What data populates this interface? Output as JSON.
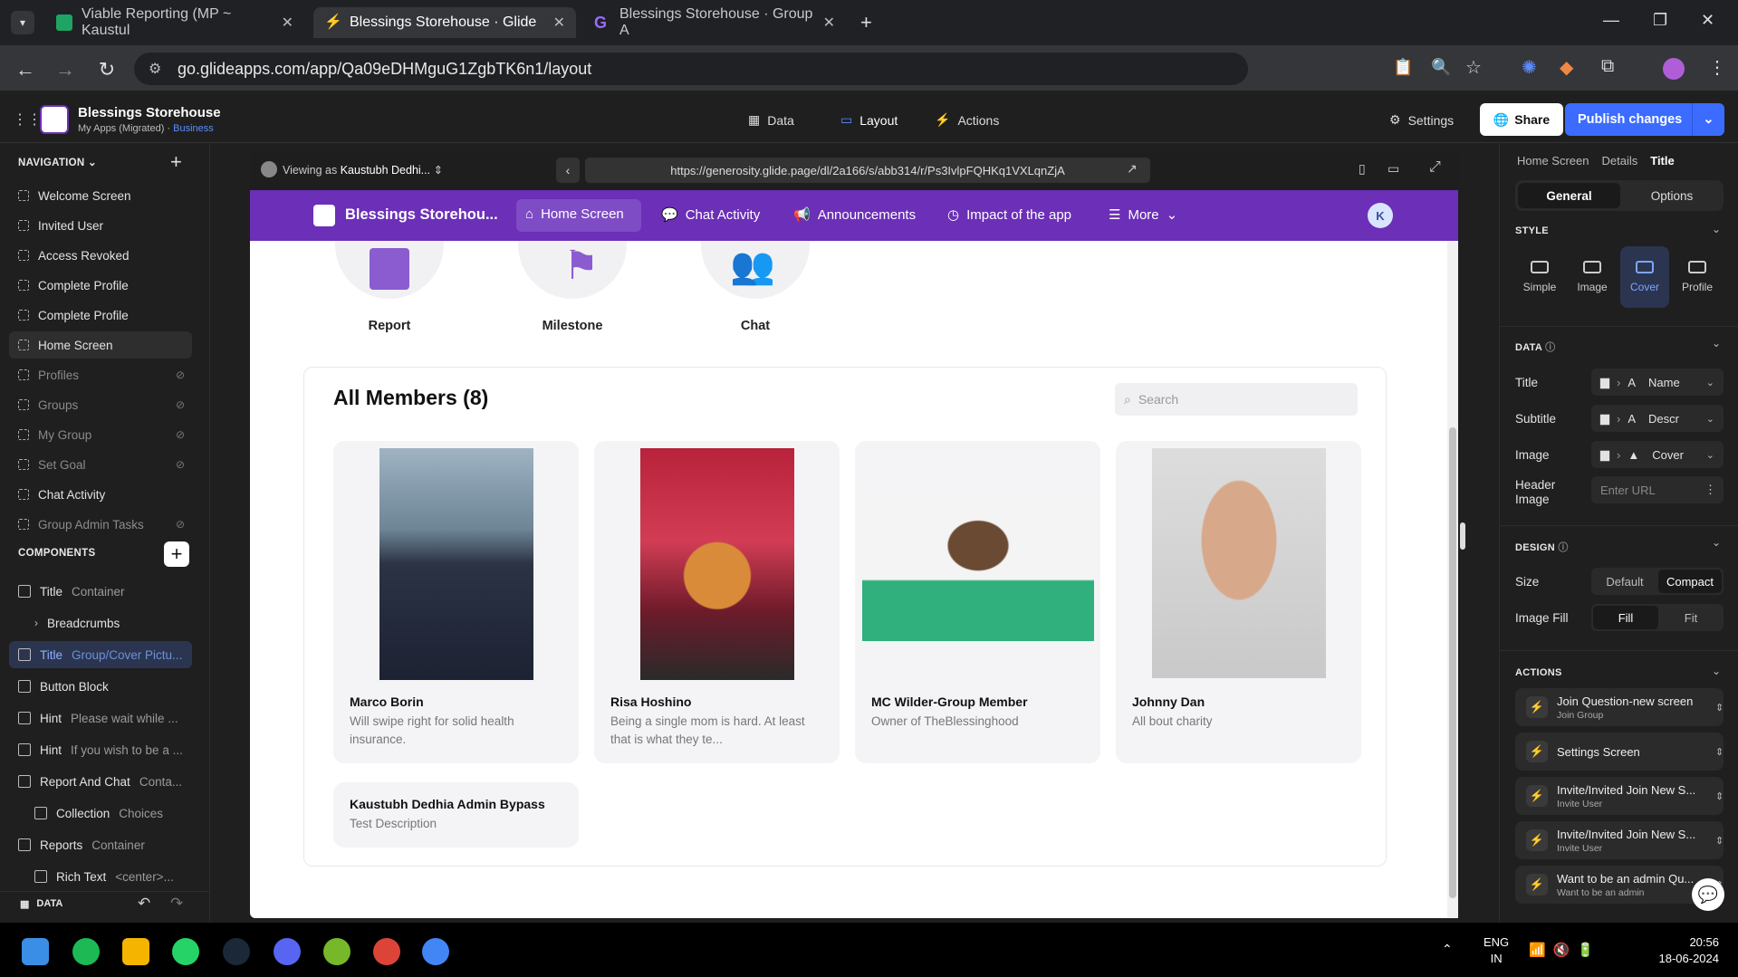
{
  "browser": {
    "tabs": [
      {
        "title": "Viable Reporting (MP ~ Kaustul",
        "color": "#1fa463"
      },
      {
        "title": "Blessings Storehouse · Glide",
        "color": "#ffffff"
      },
      {
        "title": "Blessings Storehouse · Group A",
        "color": "#9b6bff"
      }
    ],
    "url": "go.glideapps.com/app/Qa09eDHMguG1ZgbTK6n1/layout"
  },
  "app": {
    "name": "Blessings Storehouse",
    "sub": "My Apps (Migrated) ·",
    "plan": "Business",
    "topnav": [
      "Data",
      "Layout",
      "Actions"
    ],
    "settings": "Settings",
    "share": "Share",
    "publish": "Publish changes"
  },
  "left": {
    "nav_label": "NAVIGATION",
    "screens": [
      {
        "label": "Welcome Screen",
        "hidden": false
      },
      {
        "label": "Invited User",
        "hidden": false
      },
      {
        "label": "Access Revoked",
        "hidden": false
      },
      {
        "label": "Complete Profile",
        "hidden": false
      },
      {
        "label": "Complete Profile",
        "hidden": false
      },
      {
        "label": "Home Screen",
        "hidden": false
      },
      {
        "label": "Profiles",
        "hidden": true
      },
      {
        "label": "Groups",
        "hidden": true
      },
      {
        "label": "My Group",
        "hidden": true
      },
      {
        "label": "Set Goal",
        "hidden": true
      },
      {
        "label": "Chat Activity",
        "hidden": false
      },
      {
        "label": "Group Admin Tasks",
        "hidden": true
      }
    ],
    "comp_label": "COMPONENTS",
    "components": [
      {
        "name": "Title",
        "sub": "Container"
      },
      {
        "name": "Breadcrumbs",
        "sub": ""
      },
      {
        "name": "Title",
        "sub": "Group/Cover Pictu..."
      },
      {
        "name": "Button Block",
        "sub": ""
      },
      {
        "name": "Hint",
        "sub": "Please wait while ..."
      },
      {
        "name": "Hint",
        "sub": "If you wish to be a ..."
      },
      {
        "name": "Report And Chat",
        "sub": "Conta..."
      },
      {
        "name": "Collection",
        "sub": "Choices"
      },
      {
        "name": "Reports",
        "sub": "Container"
      },
      {
        "name": "Rich Text",
        "sub": "<center>..."
      }
    ],
    "data_label": "DATA"
  },
  "preview": {
    "viewing": "Viewing as",
    "viewer": "Kaustubh Dedhi...",
    "url": "https://generosity.glide.page/dl/2a166/s/abb314/r/Ps3IvlpFQHKq1VXLqnZjA",
    "appname": "Blessings Storehou...",
    "nav": [
      "Home Screen",
      "Chat Activity",
      "Announcements",
      "Impact of the app",
      "More"
    ],
    "avatar": "K",
    "buttons": [
      "Report",
      "Milestone",
      "Chat"
    ],
    "members_title": "All Members (8)",
    "search_placeholder": "Search",
    "members": [
      {
        "name": "Marco Borin",
        "desc": "Will swipe right for solid health insurance."
      },
      {
        "name": "Risa Hoshino",
        "desc": "Being a single mom is hard. At least that is what they te..."
      },
      {
        "name": "MC Wilder-Group Member",
        "desc": "Owner of TheBlessinghood"
      },
      {
        "name": "Johnny Dan",
        "desc": "All bout charity"
      },
      {
        "name": "Kaustubh Dedhia Admin Bypass",
        "desc": "Test Description"
      }
    ]
  },
  "right": {
    "crumbs": [
      "Home Screen",
      "Details",
      "Title"
    ],
    "tabs": [
      "General",
      "Options"
    ],
    "style_label": "STYLE",
    "styles": [
      "Simple",
      "Image",
      "Cover",
      "Profile"
    ],
    "data_label": "DATA",
    "fields": [
      {
        "label": "Title",
        "type": "A",
        "value": "Name"
      },
      {
        "label": "Subtitle",
        "type": "A",
        "value": "Descr"
      },
      {
        "label": "Image",
        "type": "img",
        "value": "Cover"
      }
    ],
    "header_label": "Header Image",
    "header_placeholder": "Enter URL",
    "design_label": "DESIGN",
    "size_label": "Size",
    "size_opts": [
      "Default",
      "Compact"
    ],
    "fill_label": "Image Fill",
    "fill_opts": [
      "Fill",
      "Fit"
    ],
    "actions_label": "ACTIONS",
    "actions": [
      {
        "t1": "Join Question-new screen",
        "t2": "Join Group"
      },
      {
        "t1": "Settings Screen",
        "t2": ""
      },
      {
        "t1": "Invite/Invited Join New S...",
        "t2": "Invite User"
      },
      {
        "t1": "Invite/Invited Join New S...",
        "t2": "Invite User"
      },
      {
        "t1": "Want to be an admin Qu...",
        "t2": "Want to be an admin"
      }
    ]
  },
  "taskbar": {
    "lang1": "ENG",
    "lang2": "IN",
    "time": "20:56",
    "date": "18-06-2024"
  },
  "colors": {
    "purple": "#6c2fb7",
    "blue": "#3b6cff"
  }
}
